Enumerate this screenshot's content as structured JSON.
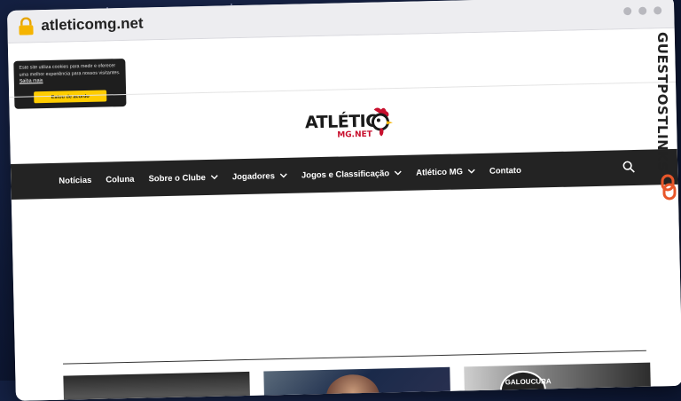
{
  "browser": {
    "url": "atleticomg.net"
  },
  "cookie_banner": {
    "text": "Este site utiliza cookies para medir e oferecer uma melhor experiência para nossos visitantes.",
    "link_label": "Saiba mais",
    "accept_label": "Estou de acordo"
  },
  "logo": {
    "main": "ATLÉTIC",
    "sub": "MG.NET"
  },
  "nav": {
    "items": [
      {
        "label": "Notícias",
        "dropdown": false
      },
      {
        "label": "Coluna",
        "dropdown": false
      },
      {
        "label": "Sobre o Clube",
        "dropdown": true
      },
      {
        "label": "Jogadores",
        "dropdown": true
      },
      {
        "label": "Jogos e Classificação",
        "dropdown": true
      },
      {
        "label": "Atlético MG",
        "dropdown": true
      },
      {
        "label": "Contato",
        "dropdown": false
      }
    ]
  },
  "watermark": {
    "text": "GUESTPOSTLINKS"
  },
  "cards": {
    "card3_overlay": "GALOUCURA"
  },
  "colors": {
    "nav_bg": "#232323",
    "cookie_button": "#ffcc00",
    "logo_red": "#c8102e",
    "watermark_accent": "#e8562a"
  }
}
